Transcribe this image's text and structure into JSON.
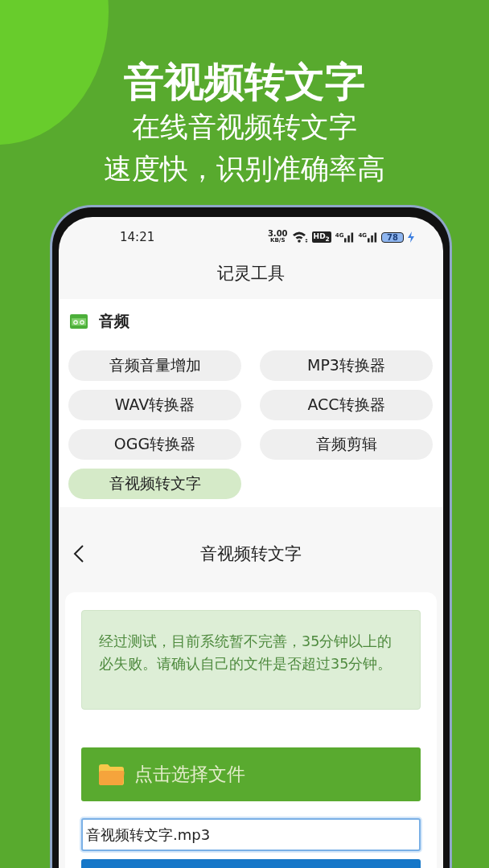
{
  "promo": {
    "headline": "音视频转文字",
    "subtitle_lines": [
      "在线音视频转文字",
      "速度快，识别准确率高"
    ]
  },
  "status_bar": {
    "time": "14:21",
    "net_speed": "3.00",
    "net_unit": "KB/S",
    "hd": "HD$_{2}$",
    "signals": [
      "4G",
      "4G"
    ],
    "battery": "78",
    "charging": true
  },
  "app_title": "记灵工具",
  "section": {
    "title": "音频",
    "tools": [
      {
        "label": "音频音量增加",
        "selected": false
      },
      {
        "label": "MP3转换器",
        "selected": false
      },
      {
        "label": "WAV转换器",
        "selected": false
      },
      {
        "label": "ACC转换器",
        "selected": false
      },
      {
        "label": "OGG转换器",
        "selected": false
      },
      {
        "label": "音频剪辑",
        "selected": false
      },
      {
        "label": "音视频转文字",
        "selected": true
      }
    ]
  },
  "detail": {
    "title": "音视频转文字",
    "notice": "经过测试，目前系统暂不完善，35分钟以上的必失败。请确认自己的文件是否超过35分钟。",
    "choose_button": "点击选择文件",
    "file_name": {
      "value": "音视频转文字.mp3",
      "focused": true
    }
  }
}
